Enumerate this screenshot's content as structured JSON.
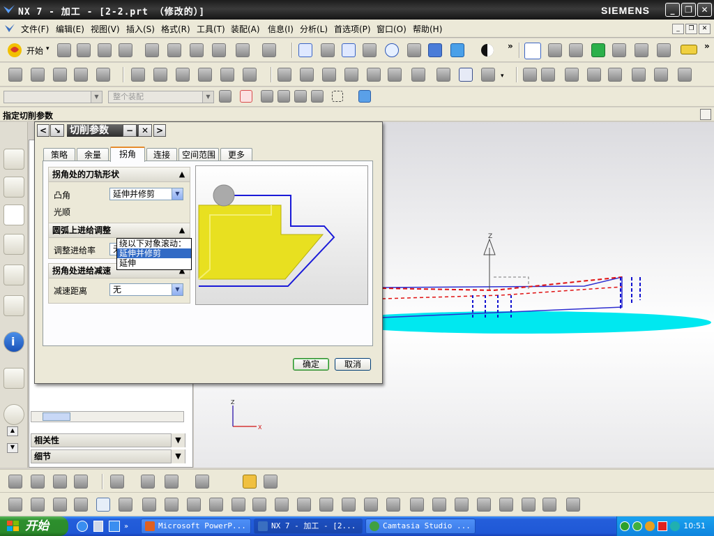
{
  "window": {
    "title": "NX 7 - 加工 - [2-2.prt （修改的）]",
    "brand": "SIEMENS"
  },
  "menubar": {
    "items": [
      "文件(F)",
      "编辑(E)",
      "视图(V)",
      "插入(S)",
      "格式(R)",
      "工具(T)",
      "装配(A)",
      "信息(I)",
      "分析(L)",
      "首选项(P)",
      "窗口(O)",
      "帮助(H)"
    ]
  },
  "toolbar": {
    "start_label": "开始",
    "assembly_combo": "整个装配"
  },
  "cue_line": "指定切削参数",
  "dialog": {
    "title": "切削参数",
    "tabs": [
      "策略",
      "余量",
      "拐角",
      "连接",
      "空间范围",
      "更多"
    ],
    "active_tab": "拐角",
    "groups": [
      {
        "title": "拐角处的刀轨形状",
        "fields": [
          {
            "label": "凸角",
            "value": "延伸并修剪"
          },
          {
            "label": "光顺",
            "value": ""
          }
        ]
      },
      {
        "title": "圆弧上进给调整",
        "fields": [
          {
            "label": "调整进给率",
            "value": "无"
          }
        ]
      },
      {
        "title": "拐角处进给减速",
        "fields": [
          {
            "label": "减速距离",
            "value": "无"
          }
        ]
      }
    ],
    "dropdown": {
      "header": "绕以下对象滚动：",
      "options": [
        "延伸并修剪",
        "延伸"
      ],
      "highlighted": "延伸并修剪"
    },
    "ok_label": "确定",
    "cancel_label": "取消"
  },
  "nav_panel": {
    "sections": [
      "相关性",
      "细节"
    ]
  },
  "axis_labels": {
    "z": "Z",
    "x": "X"
  },
  "taskbar": {
    "start_label": "开始",
    "tasks": [
      {
        "label": "Microsoft PowerP...",
        "active": false
      },
      {
        "label": "NX 7 - 加工 - [2...",
        "active": true
      },
      {
        "label": "Camtasia Studio ...",
        "active": false
      }
    ],
    "clock": "10:51"
  },
  "icons": [
    "nx-logo-icon",
    "minimize-icon",
    "restore-icon",
    "close-icon",
    "scroll-up-icon",
    "scroll-down-icon",
    "chevron-up-icon",
    "chevron-down-icon",
    "help-icon",
    "dropdown-arrow-icon"
  ],
  "colors": {
    "title_bar": "#2a2a2a",
    "dialog_title": "#3c3c3c",
    "active_tab_accent": "#e68b2c",
    "preview_part": "#e8e020",
    "preview_path": "#1a1ad8",
    "selection": "#316ac5",
    "taskbar": "#245edb",
    "start_button": "#2d8f2d"
  }
}
